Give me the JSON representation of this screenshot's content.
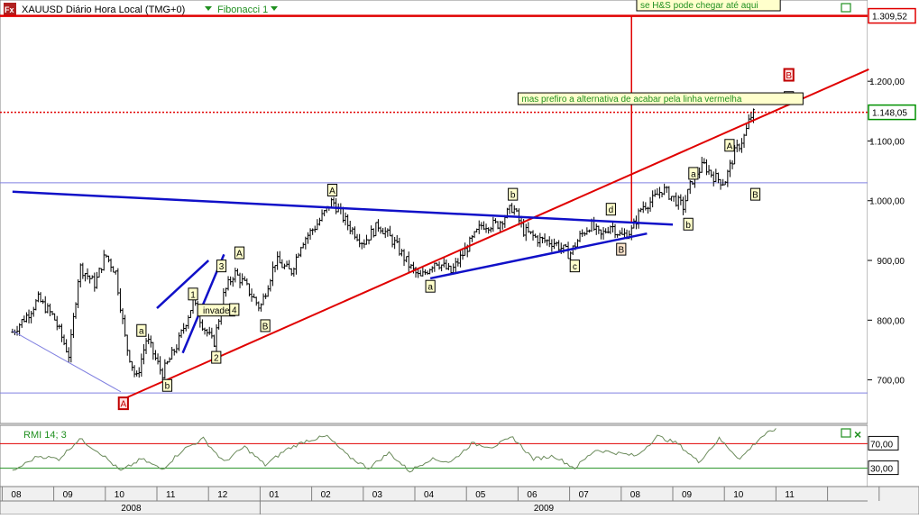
{
  "header": {
    "title": "XAUUSD Diário Hora Local (TMG+0)",
    "fib_label": "Fibonacci 1",
    "rmi_label": "RMI 14; 3",
    "close_glyph": "×"
  },
  "chart_data": {
    "type": "ohlc",
    "y_ticks": [
      {
        "value": 700,
        "label": "700,00"
      },
      {
        "value": 800,
        "label": "800,00"
      },
      {
        "value": 900,
        "label": "900,00"
      },
      {
        "value": 1000,
        "label": "1.000,00"
      },
      {
        "value": 1100,
        "label": "1.100,00"
      },
      {
        "value": 1200,
        "label": "1.200,00"
      }
    ],
    "ylim": [
      630,
      1330
    ],
    "price_flags": [
      {
        "value": 1309.52,
        "label": "1.309,52",
        "color": "#e00000"
      },
      {
        "value": 1148.05,
        "label": "1.148,05",
        "color": "#009000"
      }
    ],
    "reference_line": 1030,
    "low_reference": 678,
    "x_months": [
      {
        "label": "08",
        "m": 0
      },
      {
        "label": "09",
        "m": 1
      },
      {
        "label": "10",
        "m": 2
      },
      {
        "label": "11",
        "m": 3
      },
      {
        "label": "12",
        "m": 4
      },
      {
        "label": "01",
        "m": 5
      },
      {
        "label": "02",
        "m": 6
      },
      {
        "label": "03",
        "m": 7
      },
      {
        "label": "04",
        "m": 8
      },
      {
        "label": "05",
        "m": 9
      },
      {
        "label": "06",
        "m": 10
      },
      {
        "label": "07",
        "m": 11
      },
      {
        "label": "08",
        "m": 12
      },
      {
        "label": "09",
        "m": 13
      },
      {
        "label": "10",
        "m": 14
      },
      {
        "label": "11",
        "m": 15
      },
      {
        "label": "",
        "m": 16
      },
      {
        "label": "",
        "m": 17
      }
    ],
    "x_years": [
      {
        "label": "2008",
        "m": 2
      },
      {
        "label": "2009",
        "m": 10
      }
    ],
    "price_path": [
      [
        -0.3,
        780
      ],
      [
        0.0,
        810
      ],
      [
        0.2,
        835
      ],
      [
        0.5,
        805
      ],
      [
        0.8,
        740
      ],
      [
        1.0,
        890
      ],
      [
        1.3,
        860
      ],
      [
        1.5,
        910
      ],
      [
        1.7,
        880
      ],
      [
        1.9,
        760
      ],
      [
        2.1,
        700
      ],
      [
        2.3,
        770
      ],
      [
        2.6,
        710
      ],
      [
        2.9,
        760
      ],
      [
        3.2,
        830
      ],
      [
        3.4,
        790
      ],
      [
        3.6,
        760
      ],
      [
        3.8,
        845
      ],
      [
        4.0,
        880
      ],
      [
        4.2,
        860
      ],
      [
        4.5,
        820
      ],
      [
        4.8,
        900
      ],
      [
        5.1,
        880
      ],
      [
        5.3,
        930
      ],
      [
        5.6,
        960
      ],
      [
        5.9,
        1000
      ],
      [
        6.2,
        960
      ],
      [
        6.5,
        930
      ],
      [
        6.8,
        960
      ],
      [
        7.1,
        930
      ],
      [
        7.4,
        890
      ],
      [
        7.6,
        870
      ],
      [
        7.9,
        900
      ],
      [
        8.2,
        880
      ],
      [
        8.5,
        920
      ],
      [
        8.8,
        960
      ],
      [
        9.1,
        960
      ],
      [
        9.4,
        990
      ],
      [
        9.6,
        950
      ],
      [
        9.9,
        935
      ],
      [
        10.2,
        930
      ],
      [
        10.5,
        910
      ],
      [
        10.7,
        940
      ],
      [
        10.9,
        960
      ],
      [
        11.1,
        940
      ],
      [
        11.3,
        960
      ],
      [
        11.5,
        940
      ],
      [
        11.7,
        950
      ],
      [
        11.9,
        990
      ],
      [
        12.1,
        1000
      ],
      [
        12.3,
        1020
      ],
      [
        12.5,
        1005
      ],
      [
        12.7,
        990
      ],
      [
        12.9,
        1040
      ],
      [
        13.1,
        1060
      ],
      [
        13.3,
        1040
      ],
      [
        13.5,
        1030
      ],
      [
        13.7,
        1080
      ],
      [
        13.9,
        1110
      ],
      [
        14.0,
        1140
      ],
      [
        14.1,
        1148
      ]
    ],
    "trendlines": [
      {
        "color": "#e00000",
        "width": 2,
        "dash": "",
        "from": [
          1.8,
          666
        ],
        "to": [
          16.3,
          1220
        ]
      },
      {
        "color": "#1010c8",
        "width": 2.5,
        "dash": "",
        "from": [
          -0.3,
          1015
        ],
        "to": [
          12.5,
          960
        ]
      },
      {
        "color": "#1010c8",
        "width": 2.5,
        "dash": "",
        "from": [
          7.8,
          870
        ],
        "to": [
          12.0,
          945
        ]
      },
      {
        "color": "#1010c8",
        "width": 2.5,
        "dash": "",
        "from": [
          2.5,
          820
        ],
        "to": [
          3.5,
          900
        ]
      },
      {
        "color": "#1010c8",
        "width": 2.5,
        "dash": "",
        "from": [
          3.0,
          745
        ],
        "to": [
          3.8,
          910
        ]
      },
      {
        "color": "#8080e0",
        "width": 1,
        "dash": "",
        "from": [
          -0.3,
          782
        ],
        "to": [
          1.8,
          680
        ]
      },
      {
        "color": "#e00000",
        "width": 1.5,
        "dash": "",
        "from": [
          11.7,
          965
        ],
        "to": [
          11.7,
          1309.52
        ]
      }
    ],
    "wave_labels": [
      {
        "text": "A",
        "m": 1.85,
        "value": 660,
        "style": "red"
      },
      {
        "text": "a",
        "m": 2.2,
        "value": 782,
        "style": "box"
      },
      {
        "text": "b",
        "m": 2.7,
        "value": 690,
        "style": "box"
      },
      {
        "text": "1",
        "m": 3.2,
        "value": 843,
        "style": "box"
      },
      {
        "text": "invade",
        "m": 3.65,
        "value": 816,
        "style": "box"
      },
      {
        "text": "2",
        "m": 3.65,
        "value": 737,
        "style": "box"
      },
      {
        "text": "3",
        "m": 3.75,
        "value": 890,
        "style": "box"
      },
      {
        "text": "4",
        "m": 4.0,
        "value": 817,
        "style": "box"
      },
      {
        "text": "A",
        "m": 4.1,
        "value": 912,
        "style": "box"
      },
      {
        "text": "B",
        "m": 4.6,
        "value": 790,
        "style": "box"
      },
      {
        "text": "A",
        "m": 5.9,
        "value": 1017,
        "style": "box"
      },
      {
        "text": "a",
        "m": 7.8,
        "value": 856,
        "style": "box"
      },
      {
        "text": "b",
        "m": 9.4,
        "value": 1010,
        "style": "box"
      },
      {
        "text": "c",
        "m": 10.6,
        "value": 890,
        "style": "box"
      },
      {
        "text": "d",
        "m": 11.3,
        "value": 985,
        "style": "box"
      },
      {
        "text": "B",
        "m": 11.5,
        "value": 918,
        "style": "light"
      },
      {
        "text": "b",
        "m": 12.8,
        "value": 960,
        "style": "box"
      },
      {
        "text": "a",
        "m": 12.9,
        "value": 1045,
        "style": "box"
      },
      {
        "text": "A",
        "m": 13.6,
        "value": 1092,
        "style": "box"
      },
      {
        "text": "B",
        "m": 14.1,
        "value": 1010,
        "style": "box"
      },
      {
        "text": "C",
        "m": 14.75,
        "value": 1172,
        "style": "white"
      },
      {
        "text": "B",
        "m": 14.75,
        "value": 1210,
        "style": "red"
      }
    ],
    "annotations": [
      {
        "text": "se H&S pode chegar até aqui",
        "m": 11.8,
        "value": 1327
      },
      {
        "text": "mas prefiro a alternativa de acabar pela linha vermelha",
        "m": 9.5,
        "value": 1170
      }
    ],
    "rmi": {
      "levels": [
        {
          "value": 70,
          "label": "70,00"
        },
        {
          "value": 30,
          "label": "30,00"
        }
      ],
      "ylim": [
        0,
        100
      ],
      "path": [
        [
          -0.3,
          25
        ],
        [
          0.2,
          50
        ],
        [
          0.6,
          45
        ],
        [
          1.0,
          78
        ],
        [
          1.4,
          55
        ],
        [
          1.8,
          25
        ],
        [
          2.2,
          45
        ],
        [
          2.6,
          28
        ],
        [
          3.0,
          60
        ],
        [
          3.4,
          78
        ],
        [
          3.8,
          40
        ],
        [
          4.2,
          65
        ],
        [
          4.6,
          35
        ],
        [
          5.0,
          60
        ],
        [
          5.4,
          75
        ],
        [
          5.8,
          82
        ],
        [
          6.2,
          50
        ],
        [
          6.6,
          30
        ],
        [
          7.0,
          55
        ],
        [
          7.4,
          25
        ],
        [
          7.8,
          45
        ],
        [
          8.2,
          40
        ],
        [
          8.6,
          70
        ],
        [
          9.0,
          65
        ],
        [
          9.4,
          80
        ],
        [
          9.8,
          45
        ],
        [
          10.2,
          50
        ],
        [
          10.6,
          30
        ],
        [
          11.0,
          60
        ],
        [
          11.4,
          55
        ],
        [
          11.8,
          50
        ],
        [
          12.2,
          82
        ],
        [
          12.6,
          70
        ],
        [
          13.0,
          40
        ],
        [
          13.4,
          78
        ],
        [
          13.8,
          45
        ],
        [
          14.2,
          80
        ],
        [
          14.5,
          95
        ]
      ]
    }
  }
}
